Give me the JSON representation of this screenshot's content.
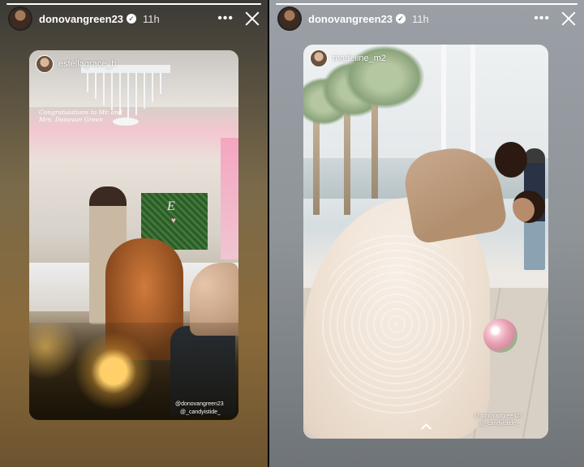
{
  "stories": [
    {
      "username": "donovangreen23",
      "time": "11h",
      "progress": 1.0,
      "repost": {
        "username": "estellagrace_h",
        "caption": "Congratulations to Mr. and Mrs. Donovan Green",
        "monogram": "E",
        "tags": [
          "@donovangreen23",
          "@_candyistide_"
        ]
      }
    },
    {
      "username": "donovangreen23",
      "time": "11h",
      "progress": 1.0,
      "repost": {
        "username": "madeline_m2",
        "tags": [
          "@donovangreen23",
          "@_candyistide_"
        ]
      }
    }
  ],
  "icons": {
    "verified": "verified-badge-icon",
    "more": "more-horizontal-icon",
    "close": "close-icon",
    "swipe_up": "chevron-up-icon"
  },
  "colors": {
    "text": "#ffffff",
    "left_bg": "#7a6a4a",
    "right_bg": "#8f9499"
  }
}
